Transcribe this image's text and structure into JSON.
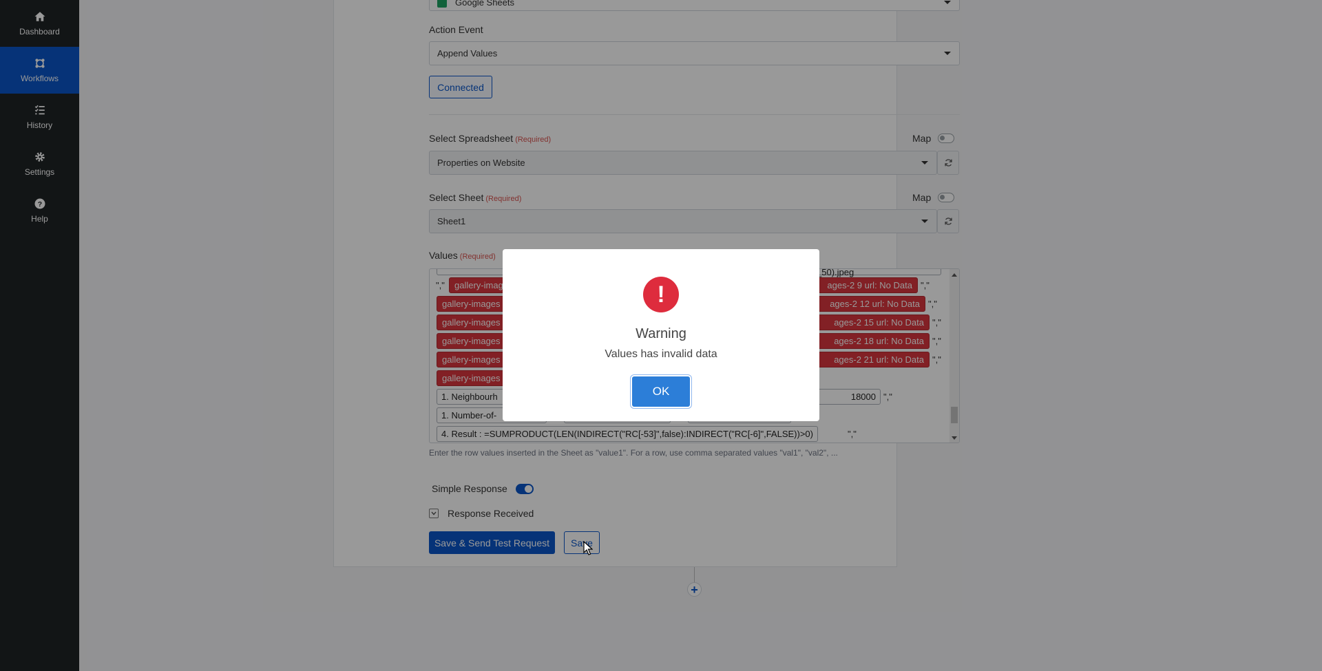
{
  "sidebar": {
    "items": [
      {
        "label": "Dashboard",
        "icon": "home-icon"
      },
      {
        "label": "Workflows",
        "icon": "workflow-icon",
        "active": true
      },
      {
        "label": "History",
        "icon": "list-check-icon"
      },
      {
        "label": "Settings",
        "icon": "gear-icon"
      },
      {
        "label": "Help",
        "icon": "question-circle-icon"
      }
    ]
  },
  "form": {
    "app_select_value": "Google Sheets",
    "action_event_label": "Action Event",
    "action_event_value": "Append Values",
    "connected_label": "Connected",
    "spreadsheet_label": "Select Spreadsheet",
    "spreadsheet_required": "(Required)",
    "spreadsheet_value": "Properties on Website",
    "sheet_label": "Select Sheet",
    "sheet_required": "(Required)",
    "sheet_value": "Sheet1",
    "map_label": "Map",
    "values_label": "Values",
    "values_required": "(Required)",
    "values_help": "Enter the row values inserted in the Sheet as \"value1\". For a row, use comma separated values \"val1\", \"val2\", ...",
    "simple_response_label": "Simple Response",
    "response_received_label": "Response Received",
    "save_send_label": "Save & Send Test Request",
    "save_label": "Save"
  },
  "values_tokens": {
    "quote_sep": "\",\"",
    "row0_left": "gallery-imag",
    "row0_right": "ages-2 9 url: No Data",
    "row1_left": "gallery-images",
    "row1_right": "ages-2 12 url: No Data",
    "row2_left": "gallery-images",
    "row2_right": "ages-2 15 url: No Data",
    "row3_left": "gallery-images",
    "row3_right": "ages-2 18 url: No Data",
    "row4_left": "gallery-images",
    "row4_right": "ages-2 21 url: No Data",
    "row5_left": "gallery-images",
    "row6_left": "1. Neighbourh",
    "row6_right": "18000",
    "row7_left": "1. Number-of-",
    "row8_left": "4. Result : =SUMPRODUCT(LEN(INDIRECT(\"RC[-53]\",false):INDIRECT(\"RC[-6]\",FALSE))>0)",
    "top_partial_right": "_50).jpeg"
  },
  "modal": {
    "icon": "exclamation-icon",
    "title": "Warning",
    "message": "Values has invalid data",
    "ok_label": "OK"
  },
  "colors": {
    "sidebar_bg": "#1f2326",
    "accent": "#0a56c8",
    "error_tag": "#d9363e",
    "warning_icon": "#de2c3d",
    "ok_button": "#2c7ed8"
  }
}
